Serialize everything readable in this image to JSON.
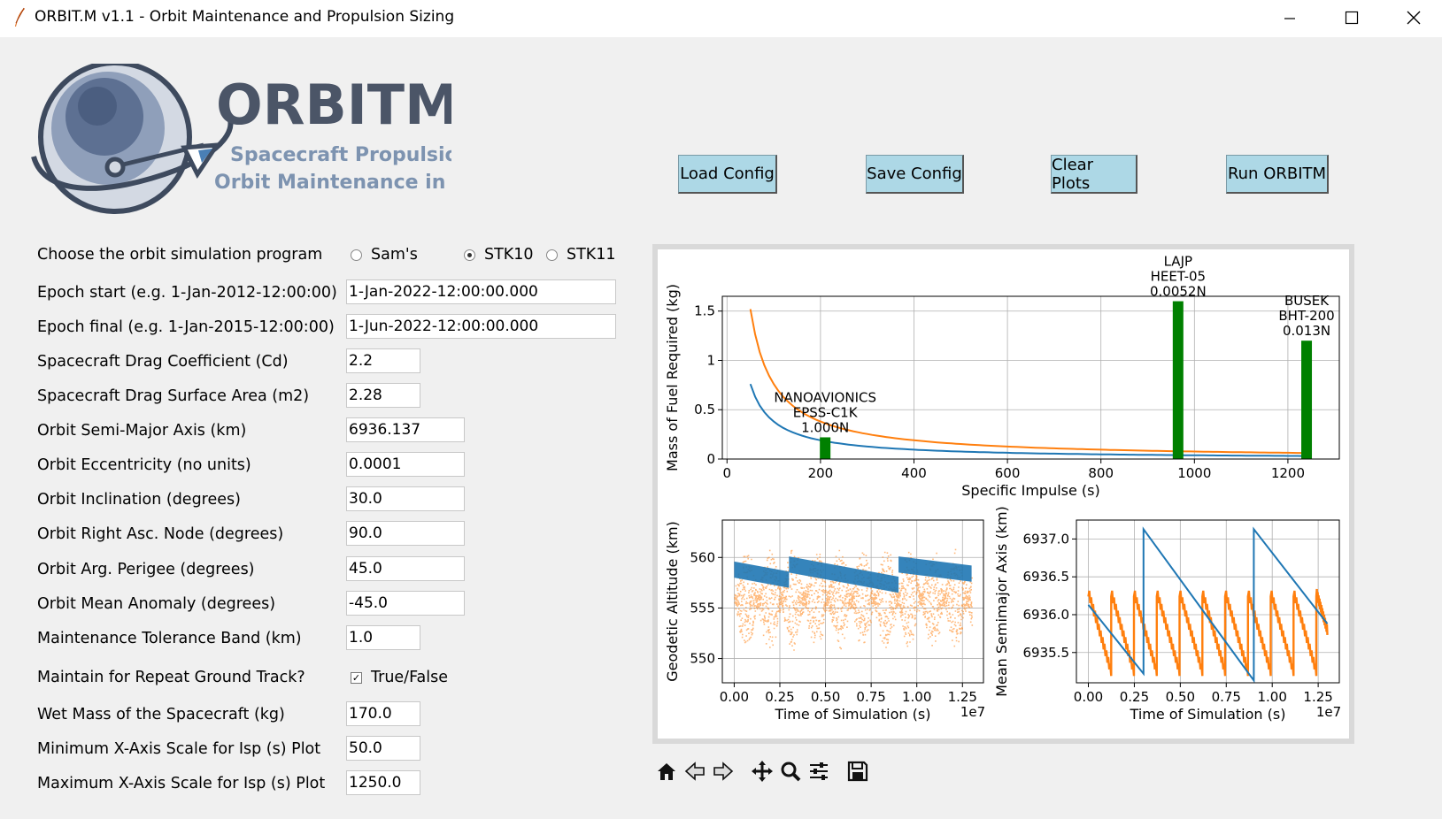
{
  "window": {
    "title": "ORBIT.M v1.1 - Orbit Maintenance and Propulsion Sizing",
    "minimize": "—",
    "maximize": "☐",
    "close": "✕"
  },
  "logo": {
    "name": "ORBITM",
    "tagline_1": "Spacecraft Propulsion &",
    "tagline_2": "Orbit Maintenance in Python"
  },
  "buttons": {
    "load": "Load Config",
    "save": "Save Config",
    "clear": "Clear Plots",
    "run": "Run ORBITM"
  },
  "form": {
    "program_label": "Choose the orbit simulation program",
    "program_options": [
      "Sam's",
      "STK10",
      "STK11"
    ],
    "program_selected": "STK10",
    "fields": [
      {
        "label": "Epoch start (e.g. 1-Jan-2012-12:00:00)",
        "value": "1-Jan-2022-12:00:00.000"
      },
      {
        "label": "Epoch final (e.g. 1-Jan-2015-12:00:00)",
        "value": "1-Jun-2022-12:00:00.000"
      },
      {
        "label": "Spacecraft Drag Coefficient (Cd)",
        "value": "2.2"
      },
      {
        "label": "Spacecraft Drag Surface Area (m2)",
        "value": "2.28"
      },
      {
        "label": "Orbit Semi-Major Axis (km)",
        "value": "6936.137"
      },
      {
        "label": "Orbit Eccentricity (no units)",
        "value": "0.0001"
      },
      {
        "label": "Orbit Inclination (degrees)",
        "value": "30.0"
      },
      {
        "label": "Orbit Right Asc. Node (degrees)",
        "value": "90.0"
      },
      {
        "label": "Orbit Arg. Perigee (degrees)",
        "value": "45.0"
      },
      {
        "label": "Orbit Mean Anomaly (degrees)",
        "value": "-45.0"
      },
      {
        "label": "Maintenance Tolerance Band (km)",
        "value": "1.0"
      },
      {
        "label": "Wet Mass of the Spacecraft (kg)",
        "value": "170.0"
      },
      {
        "label": "Minimum X-Axis Scale for Isp (s) Plot",
        "value": "50.0"
      },
      {
        "label": "Maximum X-Axis Scale for Isp (s) Plot",
        "value": "1250.0"
      }
    ],
    "rgt_label": "Maintain for Repeat Ground Track?",
    "rgt_check_label": "True/False",
    "rgt_checked": true
  },
  "chart_data": [
    {
      "type": "line",
      "xlabel": "Specific Impulse (s)",
      "ylabel": "Mass of Fuel Required (kg)",
      "xlim": [
        -10,
        1310
      ],
      "ylim": [
        0,
        1.65
      ],
      "xticks": [
        0,
        200,
        400,
        600,
        800,
        1000,
        1200
      ],
      "yticks": [
        0.0,
        0.5,
        1.0,
        1.5
      ],
      "grid": true,
      "series": [
        {
          "name": "",
          "color": "#ff7f0e",
          "x": [
            50,
            75,
            100,
            150,
            200,
            300,
            400,
            600,
            800,
            1000,
            1250
          ],
          "y": [
            1.52,
            1.01,
            0.76,
            0.51,
            0.38,
            0.25,
            0.19,
            0.127,
            0.095,
            0.076,
            0.061
          ]
        },
        {
          "name": "",
          "color": "#1f77b4",
          "x": [
            50,
            75,
            100,
            150,
            200,
            300,
            400,
            600,
            800,
            1000,
            1250
          ],
          "y": [
            0.76,
            0.51,
            0.38,
            0.25,
            0.19,
            0.127,
            0.095,
            0.063,
            0.048,
            0.038,
            0.03
          ]
        }
      ],
      "bars": [
        {
          "x": 210,
          "value": 0.22,
          "label": [
            "NANOAVIONICS",
            "EPSS-C1K",
            "1.000N"
          ]
        },
        {
          "x": 965,
          "value": 1.6,
          "label": [
            "LAJP",
            "HEET-05",
            "0.0052N"
          ]
        },
        {
          "x": 1240,
          "value": 1.2,
          "label": [
            "BUSEK",
            "BHT-200",
            "0.013N"
          ]
        }
      ],
      "bar_color": "#008000"
    },
    {
      "type": "scatter",
      "xlabel": "Time of Simulation (s)",
      "ylabel": "Geodetic Altitude (km)",
      "offset_text": "1e7",
      "xlim": [
        -0.065,
        1.365
      ],
      "ylim": [
        547.6,
        563.7
      ],
      "xticks": [
        0.0,
        0.25,
        0.5,
        0.75,
        1.0,
        1.25
      ],
      "xtick_labels": [
        "0.00",
        "0.25",
        "0.50",
        "0.75",
        "1.00",
        "1.25"
      ],
      "yticks": [
        550,
        555,
        560
      ],
      "grid": true
    },
    {
      "type": "line",
      "xlabel": "Time of Simulation (s)",
      "ylabel": "Mean Semimajor Axis (km)",
      "offset_text": "1e7",
      "xlim": [
        -0.065,
        1.365
      ],
      "ylim": [
        6935.1,
        6937.25
      ],
      "xticks": [
        0.0,
        0.25,
        0.5,
        0.75,
        1.0,
        1.25
      ],
      "xtick_labels": [
        "0.00",
        "0.25",
        "0.50",
        "0.75",
        "1.00",
        "1.25"
      ],
      "yticks": [
        6935.5,
        6936.0,
        6936.5,
        6937.0
      ],
      "ytick_labels": [
        "6935.5",
        "6936.0",
        "6936.5",
        "6937.0"
      ],
      "grid": true,
      "series": [
        {
          "name": "",
          "color": "#1f77b4",
          "x": [
            0.0,
            0.3,
            0.3,
            0.9,
            0.9,
            1.3
          ],
          "y": [
            6936.13,
            6935.22,
            6937.13,
            6935.13,
            6937.13,
            6935.88
          ]
        }
      ]
    }
  ]
}
